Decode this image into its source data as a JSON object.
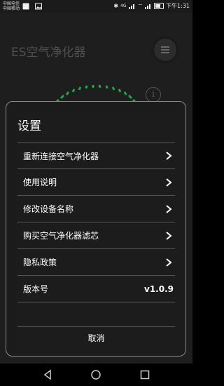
{
  "status_bar": {
    "carrier_1": "中国电信",
    "carrier_2": "中国移动",
    "network": "4G",
    "time": "下午1:31"
  },
  "app": {
    "title": "ES空气净化器"
  },
  "dialog": {
    "title": "设置",
    "items": [
      {
        "label": "重新连接空气净化器"
      },
      {
        "label": "使用说明"
      },
      {
        "label": "修改设备名称"
      },
      {
        "label": "购买空气净化器滤芯"
      },
      {
        "label": "隐私政策"
      }
    ],
    "version_label": "版本号",
    "version_value": "v1.0.9",
    "cancel_label": "取消"
  },
  "icons": {
    "menu": "menu-icon",
    "info": "info-icon",
    "chevron": "chevron-right-icon",
    "nav_back": "back-triangle-icon",
    "nav_home": "home-circle-icon",
    "nav_recent": "recent-square-icon"
  },
  "colors": {
    "gauge_green": "#1fa84a",
    "dialog_bg": "#1c1c1c",
    "dialog_border": "#8a8a8a"
  }
}
